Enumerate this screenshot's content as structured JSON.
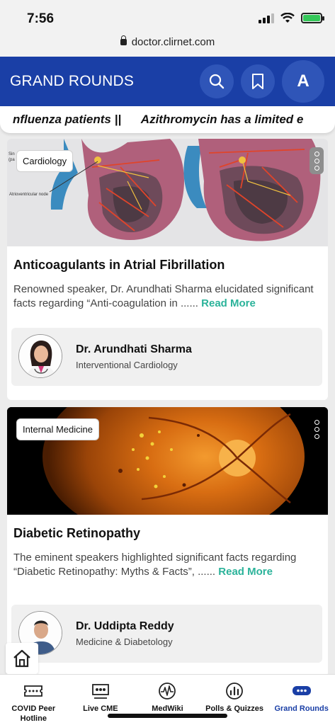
{
  "status_bar": {
    "time": "7:56"
  },
  "browser": {
    "url": "doctor.clirnet.com"
  },
  "header": {
    "title": "GRAND ROUNDS",
    "avatar_letter": "A"
  },
  "ticker": {
    "text": "nfluenza patients ||      Azithromycin has a limited e"
  },
  "cards": [
    {
      "tag": "Cardiology",
      "title": "Anticoagulants in Atrial Fibrillation",
      "description": "Renowned speaker, Dr. Arundhati Sharma elucidated significant facts regarding “Anti-coagulation in ......",
      "read_more": "Read More",
      "author_name": "Dr. Arundhati Sharma",
      "author_specialty": "Interventional Cardiology",
      "image_labels": {
        "top": "Sin (pa",
        "av_node": "Atrioventricular node"
      }
    },
    {
      "tag": "Internal Medicine",
      "title": "Diabetic Retinopathy",
      "description": "The eminent speakers highlighted significant facts regarding “Diabetic Retinopathy: Myths & Facts”, ......",
      "read_more": "Read More",
      "author_name": "Dr. Uddipta Reddy",
      "author_specialty": "Medicine & Diabetology"
    }
  ],
  "bottom_nav": [
    {
      "label": "COVID Peer Hotline",
      "icon": "ticket-icon"
    },
    {
      "label": "Live CME",
      "icon": "presentation-icon"
    },
    {
      "label": "MedWiki",
      "icon": "pulse-icon"
    },
    {
      "label": "Polls & Quizzes",
      "icon": "poll-icon"
    },
    {
      "label": "Grand Rounds",
      "icon": "chat-bubble-icon",
      "active": true
    }
  ],
  "colors": {
    "primary": "#1a3fa6",
    "accent": "#2bb39a",
    "background": "#ececec"
  }
}
